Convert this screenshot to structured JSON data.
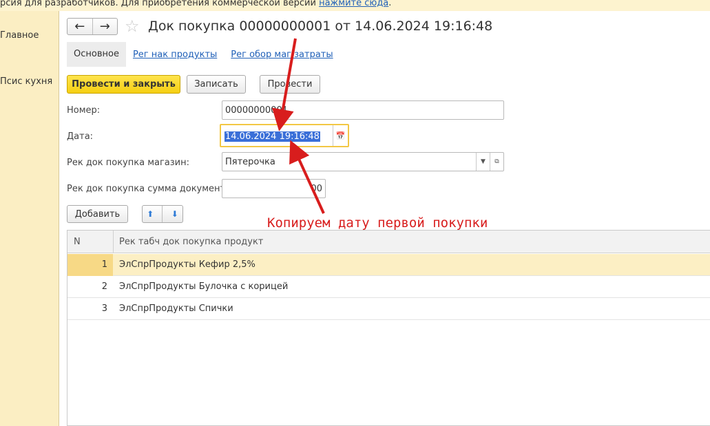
{
  "banner": {
    "text": "рсия для разработчиков. Для приобретения коммерческой версии ",
    "link": "нажмите сюда",
    "suffix": "."
  },
  "sidebar": {
    "items": [
      {
        "label": "Главное"
      },
      {
        "label": "Псис кухня"
      }
    ]
  },
  "header": {
    "title": "Док покупка 00000000001 от 14.06.2024 19:16:48",
    "back_icon": "arrow-left-icon",
    "forward_icon": "arrow-right-icon",
    "favorite_icon": "star-icon"
  },
  "tabs": [
    {
      "label": "Основное",
      "active": true
    },
    {
      "label": "Рег нак продукты",
      "active": false
    },
    {
      "label": "Рег обор маг затраты",
      "active": false
    }
  ],
  "toolbar": {
    "post_close": "Провести и закрыть",
    "save": "Записать",
    "post": "Провести"
  },
  "form": {
    "number_label": "Номер:",
    "number_value": "00000000001",
    "date_label": "Дата:",
    "date_value": "14.06.2024 19:16:48",
    "store_label": "Рек док покупка магазин:",
    "store_value": "Пятерочка",
    "sum_label": "Рек док покупка сумма документа:",
    "sum_value": "00"
  },
  "table_toolbar": {
    "add": "Добавить",
    "up_icon": "arrow-up-icon",
    "down_icon": "arrow-down-icon"
  },
  "table": {
    "columns": [
      "N",
      "Рек табч док покупка продукт"
    ],
    "rows": [
      {
        "n": "1",
        "product": "ЭлСпрПродукты Кефир 2,5%",
        "selected": true
      },
      {
        "n": "2",
        "product": "ЭлСпрПродукты Булочка с корицей",
        "selected": false
      },
      {
        "n": "3",
        "product": "ЭлСпрПродукты Спички",
        "selected": false
      }
    ]
  },
  "annotation": {
    "text": "Копируем дату первой покупки",
    "color": "#d81d1d"
  },
  "colors": {
    "accent_yellow": "#f5cf12",
    "sidebar_bg": "#fbeec3",
    "link_blue": "#2060b8",
    "selection_blue": "#3a6fd8"
  }
}
